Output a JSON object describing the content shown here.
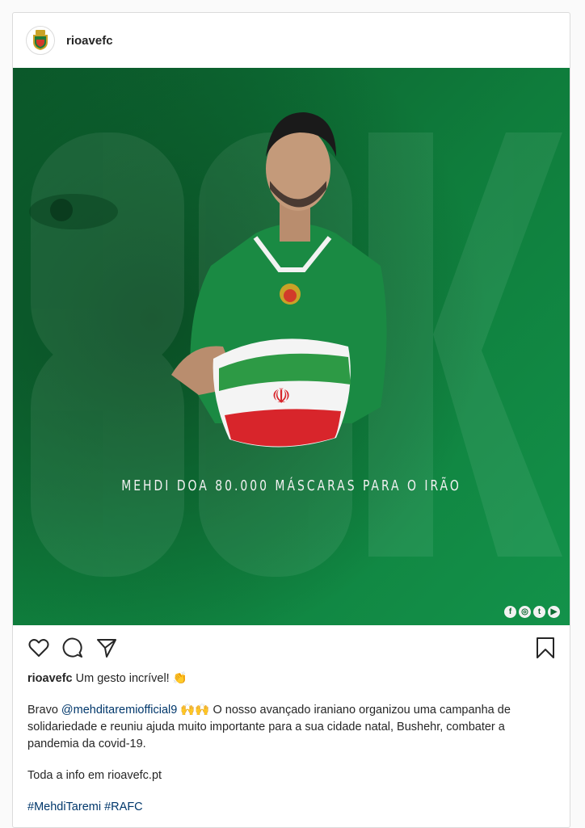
{
  "post": {
    "username": "rioavefc",
    "headline": "MEHDI DOA 80.000 MÁSCARAS PARA O IRÃO",
    "socials": [
      "facebook-icon",
      "instagram-icon",
      "twitter-icon",
      "youtube-icon"
    ],
    "caption_lead": "Um gesto incrível!",
    "caption_lead_emoji": "👏",
    "body_prefix": "Bravo",
    "mention": "@mehditaremiofficial9",
    "body_emoji": "🙌🙌",
    "body_text": "O nosso avançado iraniano organizou uma campanha de solidariedade e reuniu ajuda muito importante para a sua cidade natal, Bushehr, combater a pandemia da covid-19.",
    "info_text": "Toda a info em rioavefc.pt",
    "hashtag_1": "#MehdiTaremi",
    "hashtag_2": "#RAFC"
  },
  "colors": {
    "brand_green": "#0e7a3a",
    "link": "#00376b"
  }
}
